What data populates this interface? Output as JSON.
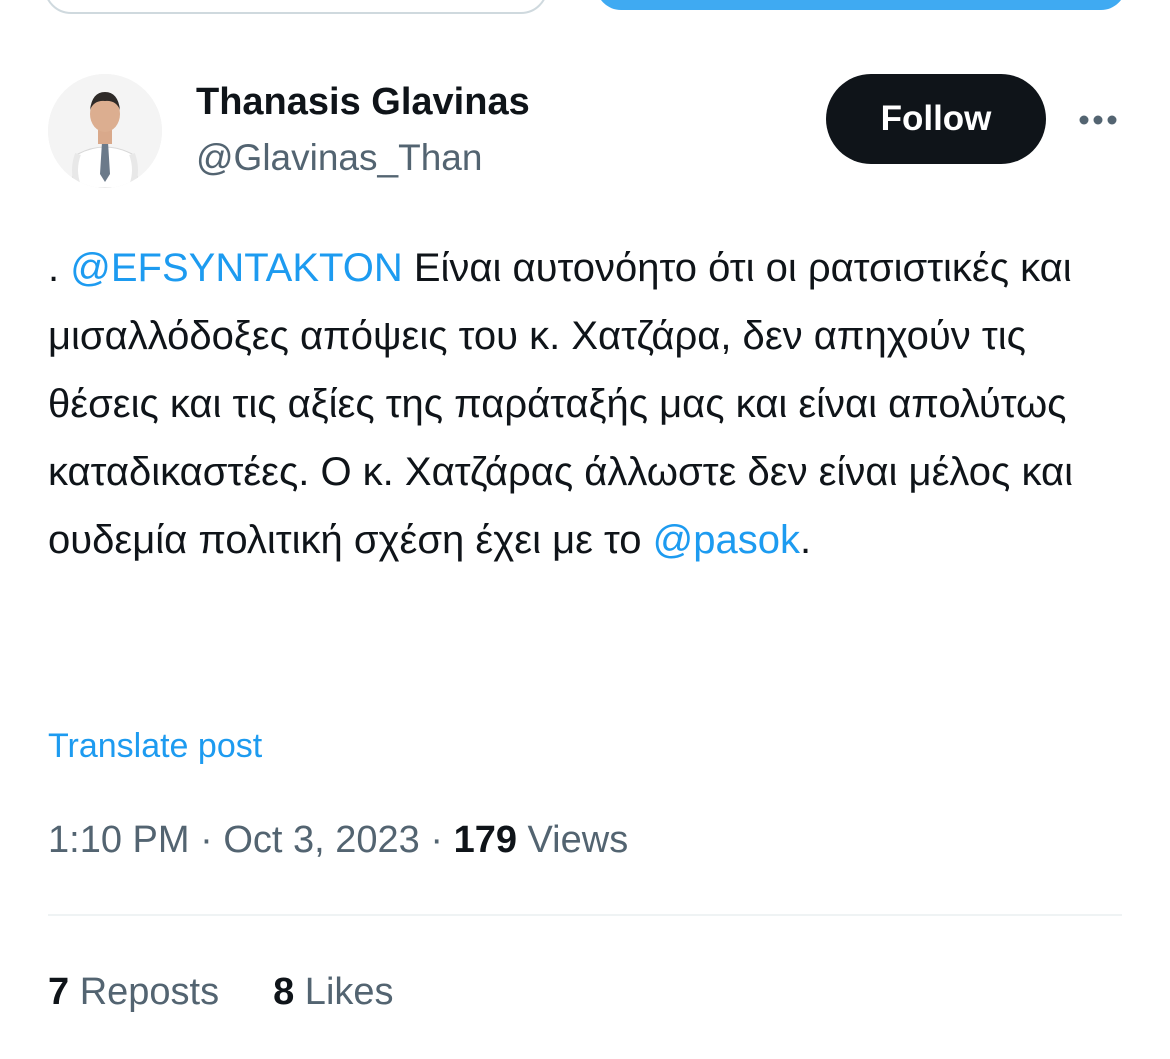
{
  "author": {
    "name": "Thanasis Glavinas",
    "handle": "@Glavinas_Than"
  },
  "actions": {
    "follow_label": "Follow",
    "more_icon": "more-horizontal-icon"
  },
  "tweet": {
    "prefix": ". ",
    "mention1": "@EFSYNTAKTON",
    "body": " Είναι αυτονόητο ότι οι ρατσιστικές και μισαλλόδοξες απόψεις του κ. Χατζάρα, δεν απηχούν τις θέσεις και τις αξίες της παράταξής μας και είναι απολύτως καταδικαστέες. Ο κ. Χατζάρας άλλωστε δεν είναι μέλος και ουδεμία πολιτική σχέση έχει με το ",
    "mention2": "@pasok",
    "suffix": "."
  },
  "translate_label": "Translate post",
  "meta": {
    "time": "1:10 PM",
    "sep1": " · ",
    "date": "Oct 3, 2023",
    "sep2": " · ",
    "views_count": "179",
    "views_label": " Views"
  },
  "stats": {
    "reposts_count": "7",
    "reposts_label": " Reposts",
    "likes_count": "8",
    "likes_label": " Likes"
  },
  "colors": {
    "accent": "#1d9bf0",
    "text": "#0f1419",
    "secondary": "#536471"
  }
}
